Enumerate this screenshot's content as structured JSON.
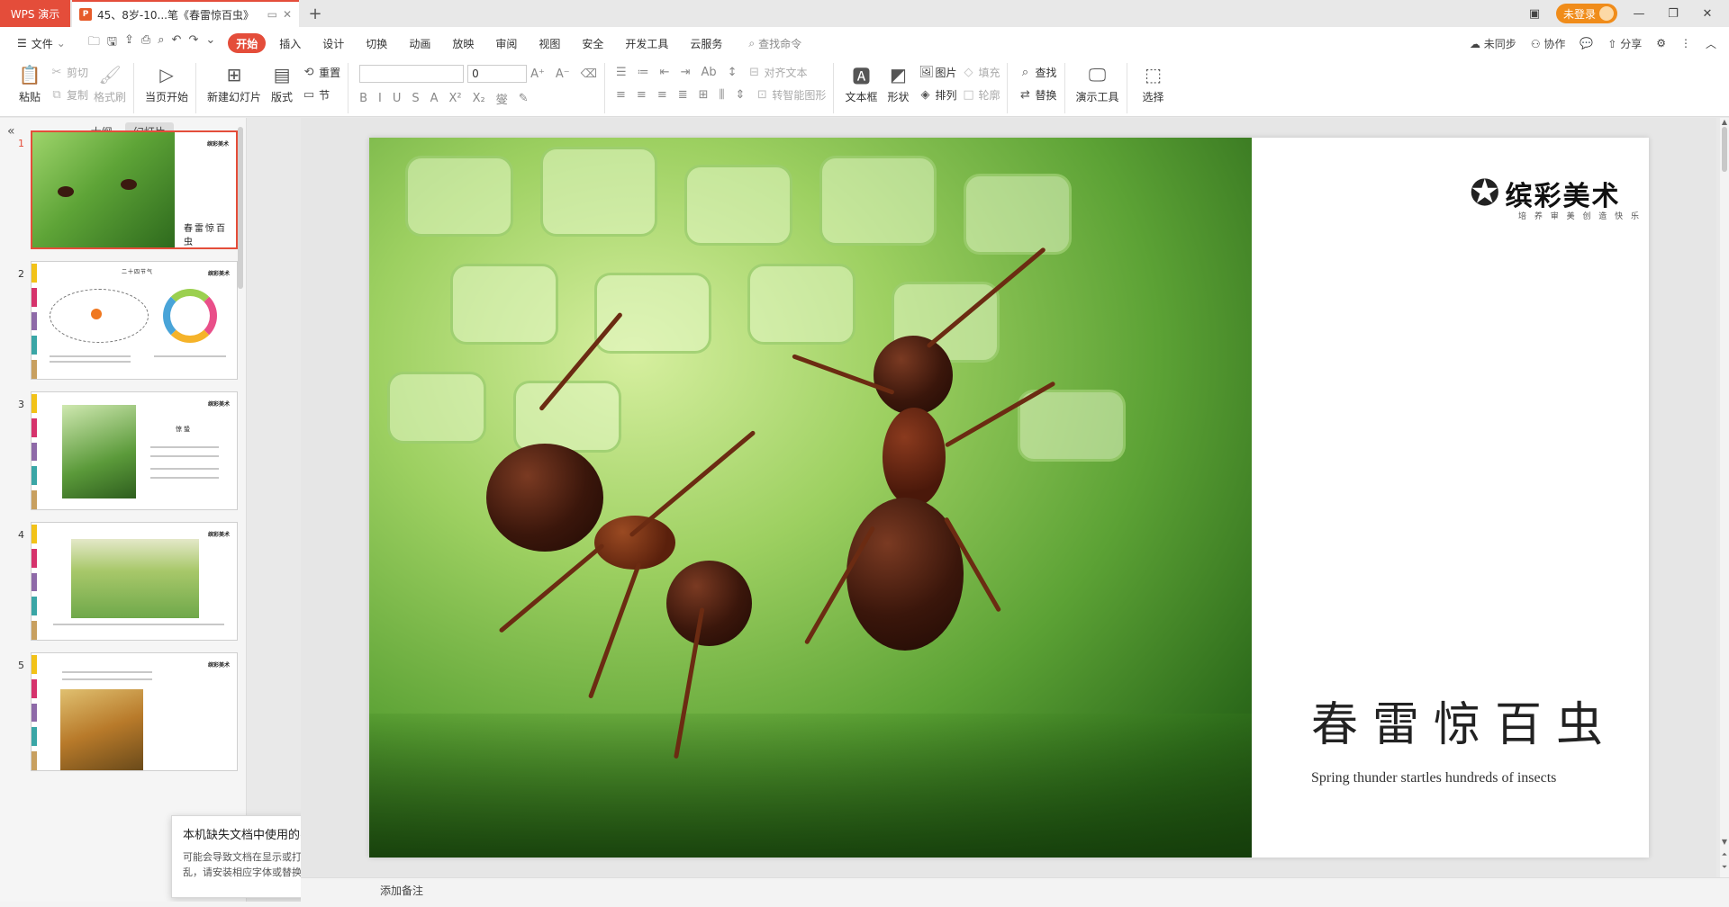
{
  "titlebar": {
    "app_name": "WPS 演示",
    "doc_tab": "45、8岁-10...笔《春雷惊百虫》",
    "login": "未登录"
  },
  "menu": {
    "file": "文件",
    "items": [
      "开始",
      "插入",
      "设计",
      "切换",
      "动画",
      "放映",
      "审阅",
      "视图",
      "安全",
      "开发工具",
      "云服务"
    ],
    "active": "开始",
    "search": "查找命令",
    "right": [
      "未同步",
      "协作",
      "分享"
    ]
  },
  "ribbon": {
    "paste": "粘贴",
    "cut": "剪切",
    "copy": "复制",
    "format_painter": "格式刷",
    "start_from_current": "当页开始",
    "new_slide": "新建幻灯片",
    "layout": "版式",
    "reset": "重置",
    "section": "节",
    "font_size": "0",
    "align_text": "对齐文本",
    "smart_graphic": "转智能图形",
    "textbox": "文本框",
    "shape": "形状",
    "picture": "图片",
    "arrange": "排列",
    "fill": "填充",
    "outline": "轮廓",
    "find": "查找",
    "replace": "替换",
    "present_tools": "演示工具",
    "select": "选择"
  },
  "leftpane": {
    "tab_outline": "大纲",
    "tab_slides": "幻灯片",
    "slide_numbers": [
      "1",
      "2",
      "3",
      "4",
      "5"
    ],
    "thumb1_title": "春雷惊百虫",
    "thumb2_title": "二十四节气",
    "thumb3_title": "惊蛰",
    "logo": "缤彩美术"
  },
  "tooltip": {
    "title": "本机缺失文档中使用的字体",
    "body": "可能会导致文档在显示或打印时显示错乱，请安装相应字体或替换为其他字体"
  },
  "slide": {
    "logo_text": "缤彩美术",
    "logo_sub": "培 养 审 美   创 造 快 乐",
    "title": "春雷惊百虫",
    "subtitle": "Spring thunder startles hundreds of insects"
  },
  "notes": {
    "placeholder": "添加备注"
  },
  "colors": {
    "accent": "#e44d3a",
    "login": "#f08c1a"
  }
}
